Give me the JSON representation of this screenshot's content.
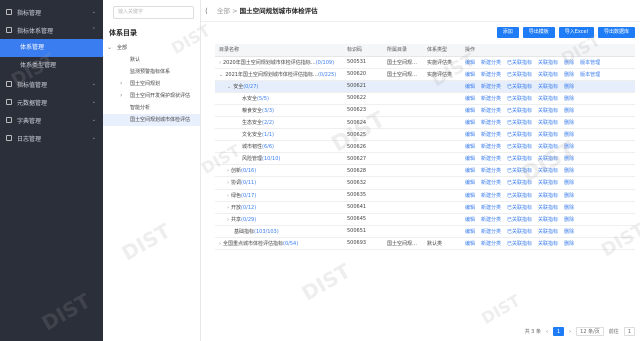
{
  "sidebar": {
    "groups": [
      {
        "label": "指标管理",
        "subs": []
      },
      {
        "label": "指标体系管理",
        "subs": [
          {
            "label": "体系管理",
            "active": true
          },
          {
            "label": "体系类型管理",
            "active": false
          }
        ]
      },
      {
        "label": "指标值管理",
        "subs": []
      },
      {
        "label": "元数据管理",
        "subs": []
      },
      {
        "label": "字典管理",
        "subs": []
      },
      {
        "label": "日志管理",
        "subs": []
      }
    ]
  },
  "tree": {
    "search_placeholder": "输入关键字",
    "title": "体系目录",
    "nodes": [
      {
        "label": "全部",
        "level": 0,
        "toggle": "⌄",
        "selected": false
      },
      {
        "label": "默认",
        "level": 1,
        "toggle": "",
        "selected": false
      },
      {
        "label": "监测预警指标体系",
        "level": 1,
        "toggle": "",
        "selected": false
      },
      {
        "label": "国土空间规划",
        "level": 1,
        "toggle": "›",
        "selected": false
      },
      {
        "label": "国土空间开发保护现状评估",
        "level": 1,
        "toggle": "›",
        "selected": false
      },
      {
        "label": "智能分析",
        "level": 1,
        "toggle": "",
        "selected": false
      },
      {
        "label": "国土空间规划城市体检评估",
        "level": 1,
        "toggle": "",
        "selected": true
      }
    ]
  },
  "breadcrumb": {
    "root": "全部",
    "sep": ">",
    "current": "国土空间规划城市体检评估"
  },
  "buttons": [
    "添加",
    "导出模板",
    "导入Excel",
    "导出数据库"
  ],
  "table": {
    "headers": [
      "目录名称",
      "标识码",
      "所属目录",
      "体系类型",
      "操作"
    ],
    "rows": [
      {
        "name": "2020年国土空间规划城市体检评估指标…",
        "count": "(0/109)",
        "indent": 0,
        "exp": "›",
        "code": "500531",
        "dir": "国土空间规…",
        "type": "实施评估类",
        "acts": [
          "编辑",
          "新建分类",
          "已关联指标",
          "关联指标",
          "删除",
          "版本管理"
        ],
        "hl": false
      },
      {
        "name": "2021年国土空间规划城市体检评估指标…",
        "count": "(0/225)",
        "indent": 0,
        "exp": "⌄",
        "code": "500620",
        "dir": "国土空间规…",
        "type": "实施评估类",
        "acts": [
          "编辑",
          "新建分类",
          "已关联指标",
          "关联指标",
          "删除",
          "版本管理"
        ],
        "hl": false
      },
      {
        "name": "安全",
        "count": "(0/27)",
        "indent": 1,
        "exp": "⌄",
        "code": "500621",
        "dir": "",
        "type": "",
        "acts": [
          "编辑",
          "新建分类",
          "已关联指标",
          "关联指标",
          "删除"
        ],
        "hl": true
      },
      {
        "name": "水安全",
        "count": "(5/5)",
        "indent": 2,
        "exp": "",
        "code": "500622",
        "dir": "",
        "type": "",
        "acts": [
          "编辑",
          "新建分类",
          "已关联指标",
          "关联指标",
          "删除"
        ],
        "hl": false
      },
      {
        "name": "粮食安全",
        "count": "(3/3)",
        "indent": 2,
        "exp": "",
        "code": "500623",
        "dir": "",
        "type": "",
        "acts": [
          "编辑",
          "新建分类",
          "已关联指标",
          "关联指标",
          "删除"
        ],
        "hl": false
      },
      {
        "name": "生态安全",
        "count": "(2/2)",
        "indent": 2,
        "exp": "",
        "code": "500624",
        "dir": "",
        "type": "",
        "acts": [
          "编辑",
          "新建分类",
          "已关联指标",
          "关联指标",
          "删除"
        ],
        "hl": false
      },
      {
        "name": "文化安全",
        "count": "(1/1)",
        "indent": 2,
        "exp": "",
        "code": "500625",
        "dir": "",
        "type": "",
        "acts": [
          "编辑",
          "新建分类",
          "已关联指标",
          "关联指标",
          "删除"
        ],
        "hl": false
      },
      {
        "name": "城市韧性",
        "count": "(6/6)",
        "indent": 2,
        "exp": "",
        "code": "500626",
        "dir": "",
        "type": "",
        "acts": [
          "编辑",
          "新建分类",
          "已关联指标",
          "关联指标",
          "删除"
        ],
        "hl": false
      },
      {
        "name": "风险管理",
        "count": "(10/10)",
        "indent": 2,
        "exp": "",
        "code": "500627",
        "dir": "",
        "type": "",
        "acts": [
          "编辑",
          "新建分类",
          "已关联指标",
          "关联指标",
          "删除"
        ],
        "hl": false
      },
      {
        "name": "创新",
        "count": "(0/16)",
        "indent": 1,
        "exp": "›",
        "code": "500628",
        "dir": "",
        "type": "",
        "acts": [
          "编辑",
          "新建分类",
          "已关联指标",
          "关联指标",
          "删除"
        ],
        "hl": false
      },
      {
        "name": "协调",
        "count": "(0/11)",
        "indent": 1,
        "exp": "›",
        "code": "500632",
        "dir": "",
        "type": "",
        "acts": [
          "编辑",
          "新建分类",
          "已关联指标",
          "关联指标",
          "删除"
        ],
        "hl": false
      },
      {
        "name": "绿色",
        "count": "(0/17)",
        "indent": 1,
        "exp": "›",
        "code": "500635",
        "dir": "",
        "type": "",
        "acts": [
          "编辑",
          "新建分类",
          "已关联指标",
          "关联指标",
          "删除"
        ],
        "hl": false
      },
      {
        "name": "开放",
        "count": "(0/12)",
        "indent": 1,
        "exp": "›",
        "code": "500641",
        "dir": "",
        "type": "",
        "acts": [
          "编辑",
          "新建分类",
          "已关联指标",
          "关联指标",
          "删除"
        ],
        "hl": false
      },
      {
        "name": "共享",
        "count": "(0/29)",
        "indent": 1,
        "exp": "›",
        "code": "500645",
        "dir": "",
        "type": "",
        "acts": [
          "编辑",
          "新建分类",
          "已关联指标",
          "关联指标",
          "删除"
        ],
        "hl": false
      },
      {
        "name": "基础指标",
        "count": "(103/103)",
        "indent": 1,
        "exp": "",
        "code": "500651",
        "dir": "",
        "type": "",
        "acts": [
          "编辑",
          "新建分类",
          "已关联指标",
          "关联指标",
          "删除"
        ],
        "hl": false
      },
      {
        "name": "全国重点城市体检评估指标",
        "count": "(0/54)",
        "indent": 0,
        "exp": "›",
        "code": "500693",
        "dir": "国土空间规…",
        "type": "默认类",
        "acts": [
          "编辑",
          "新建分类",
          "已关联指标",
          "关联指标",
          "删除"
        ],
        "hl": false
      }
    ]
  },
  "pager": {
    "total": "共 3 条",
    "prev": "‹",
    "page": "1",
    "next": "›",
    "size": "12 条/页",
    "goto": "前往",
    "goto_val": "1"
  },
  "watermark": "DIST",
  "colors": {
    "accent": "#1f7cf7",
    "sidebar": "#2b2f3a",
    "highlight": "#e6eefb"
  }
}
